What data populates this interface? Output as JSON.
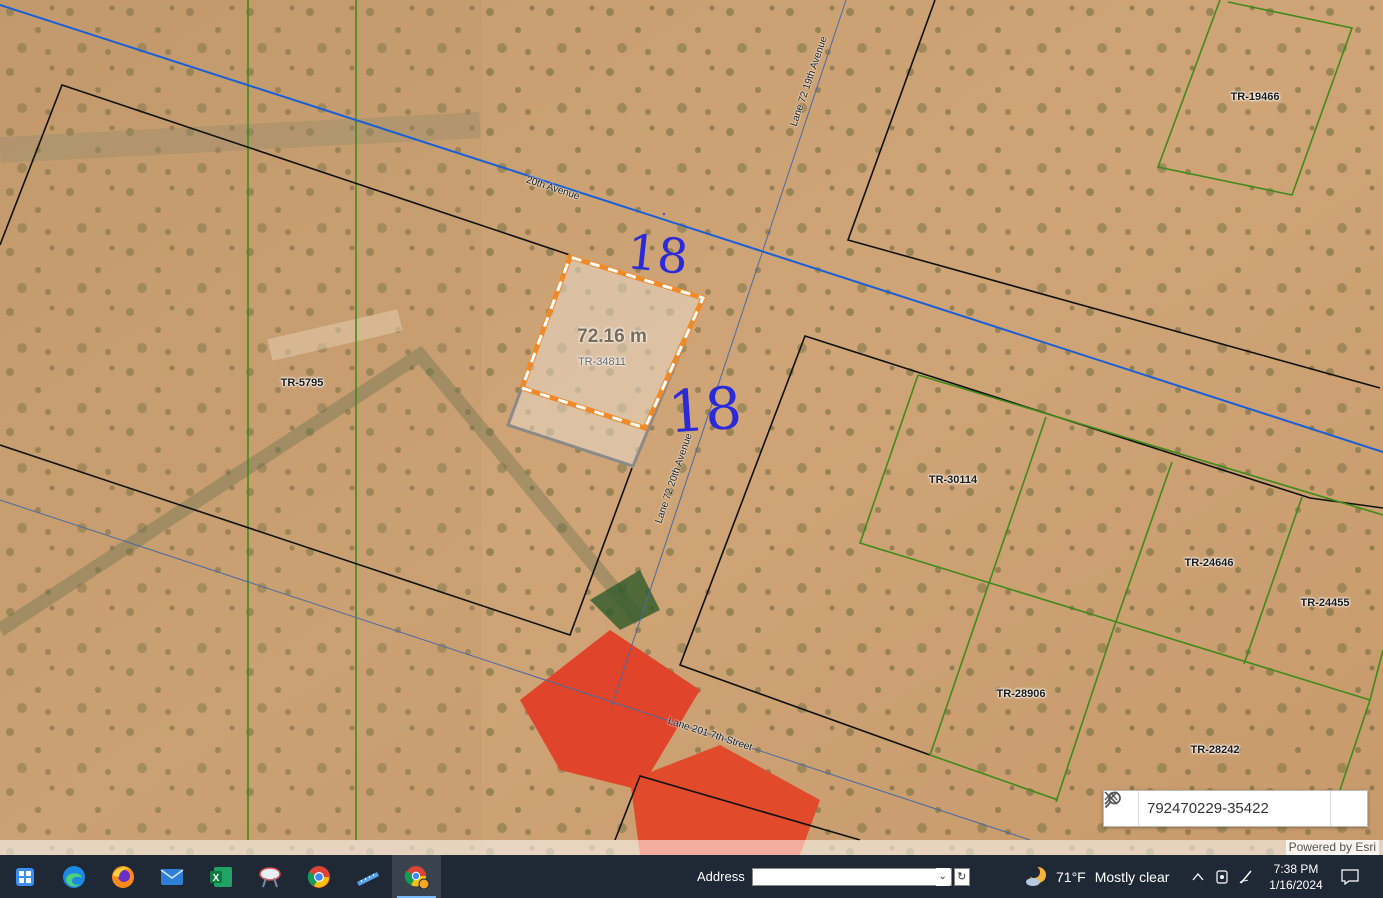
{
  "map": {
    "parcels": {
      "tr5795": "TR-5795",
      "tr34811": "TR-34811",
      "tr19466": "TR-19466",
      "tr30114": "TR-30114",
      "tr24646": "TR-24646",
      "tr24455": "TR-24455",
      "tr28906": "TR-28906",
      "tr28242": "TR-28242"
    },
    "roads": {
      "twentieth_avenue": "20th Avenue",
      "lane72_19th": "Lane 72 19th Avenue",
      "lane72_20th": "Lane 72 20th Avenue",
      "lane201_7th": "Lane 201 7th Street"
    },
    "measurement": "72.16 m",
    "annotations": {
      "top": "18",
      "right": "18"
    },
    "attribution": "Powered by Esri",
    "colors": {
      "parcel_black": "#111111",
      "parcel_green": "#3f8a1a",
      "road_blue": "#1a5fd6",
      "road_thin": "#4a6aa0",
      "selection_orange": "#f08a28"
    }
  },
  "search": {
    "value": "792470229-35422",
    "toggle_icon": "chevron-up-icon",
    "clear_icon": "close-icon",
    "go_icon": "search-icon"
  },
  "taskbar": {
    "apps": [
      "start-icon",
      "edge-icon",
      "firefox-icon",
      "mail-icon",
      "excel-icon",
      "snipping-icon",
      "chrome-icon",
      "ruler-icon",
      "chrome-profile-icon"
    ],
    "address_label": "Address",
    "address_value": "",
    "weather": {
      "temp": "71°F",
      "condition": "Mostly clear"
    },
    "clock": {
      "time": "7:38 PM",
      "date": "1/16/2024"
    }
  }
}
